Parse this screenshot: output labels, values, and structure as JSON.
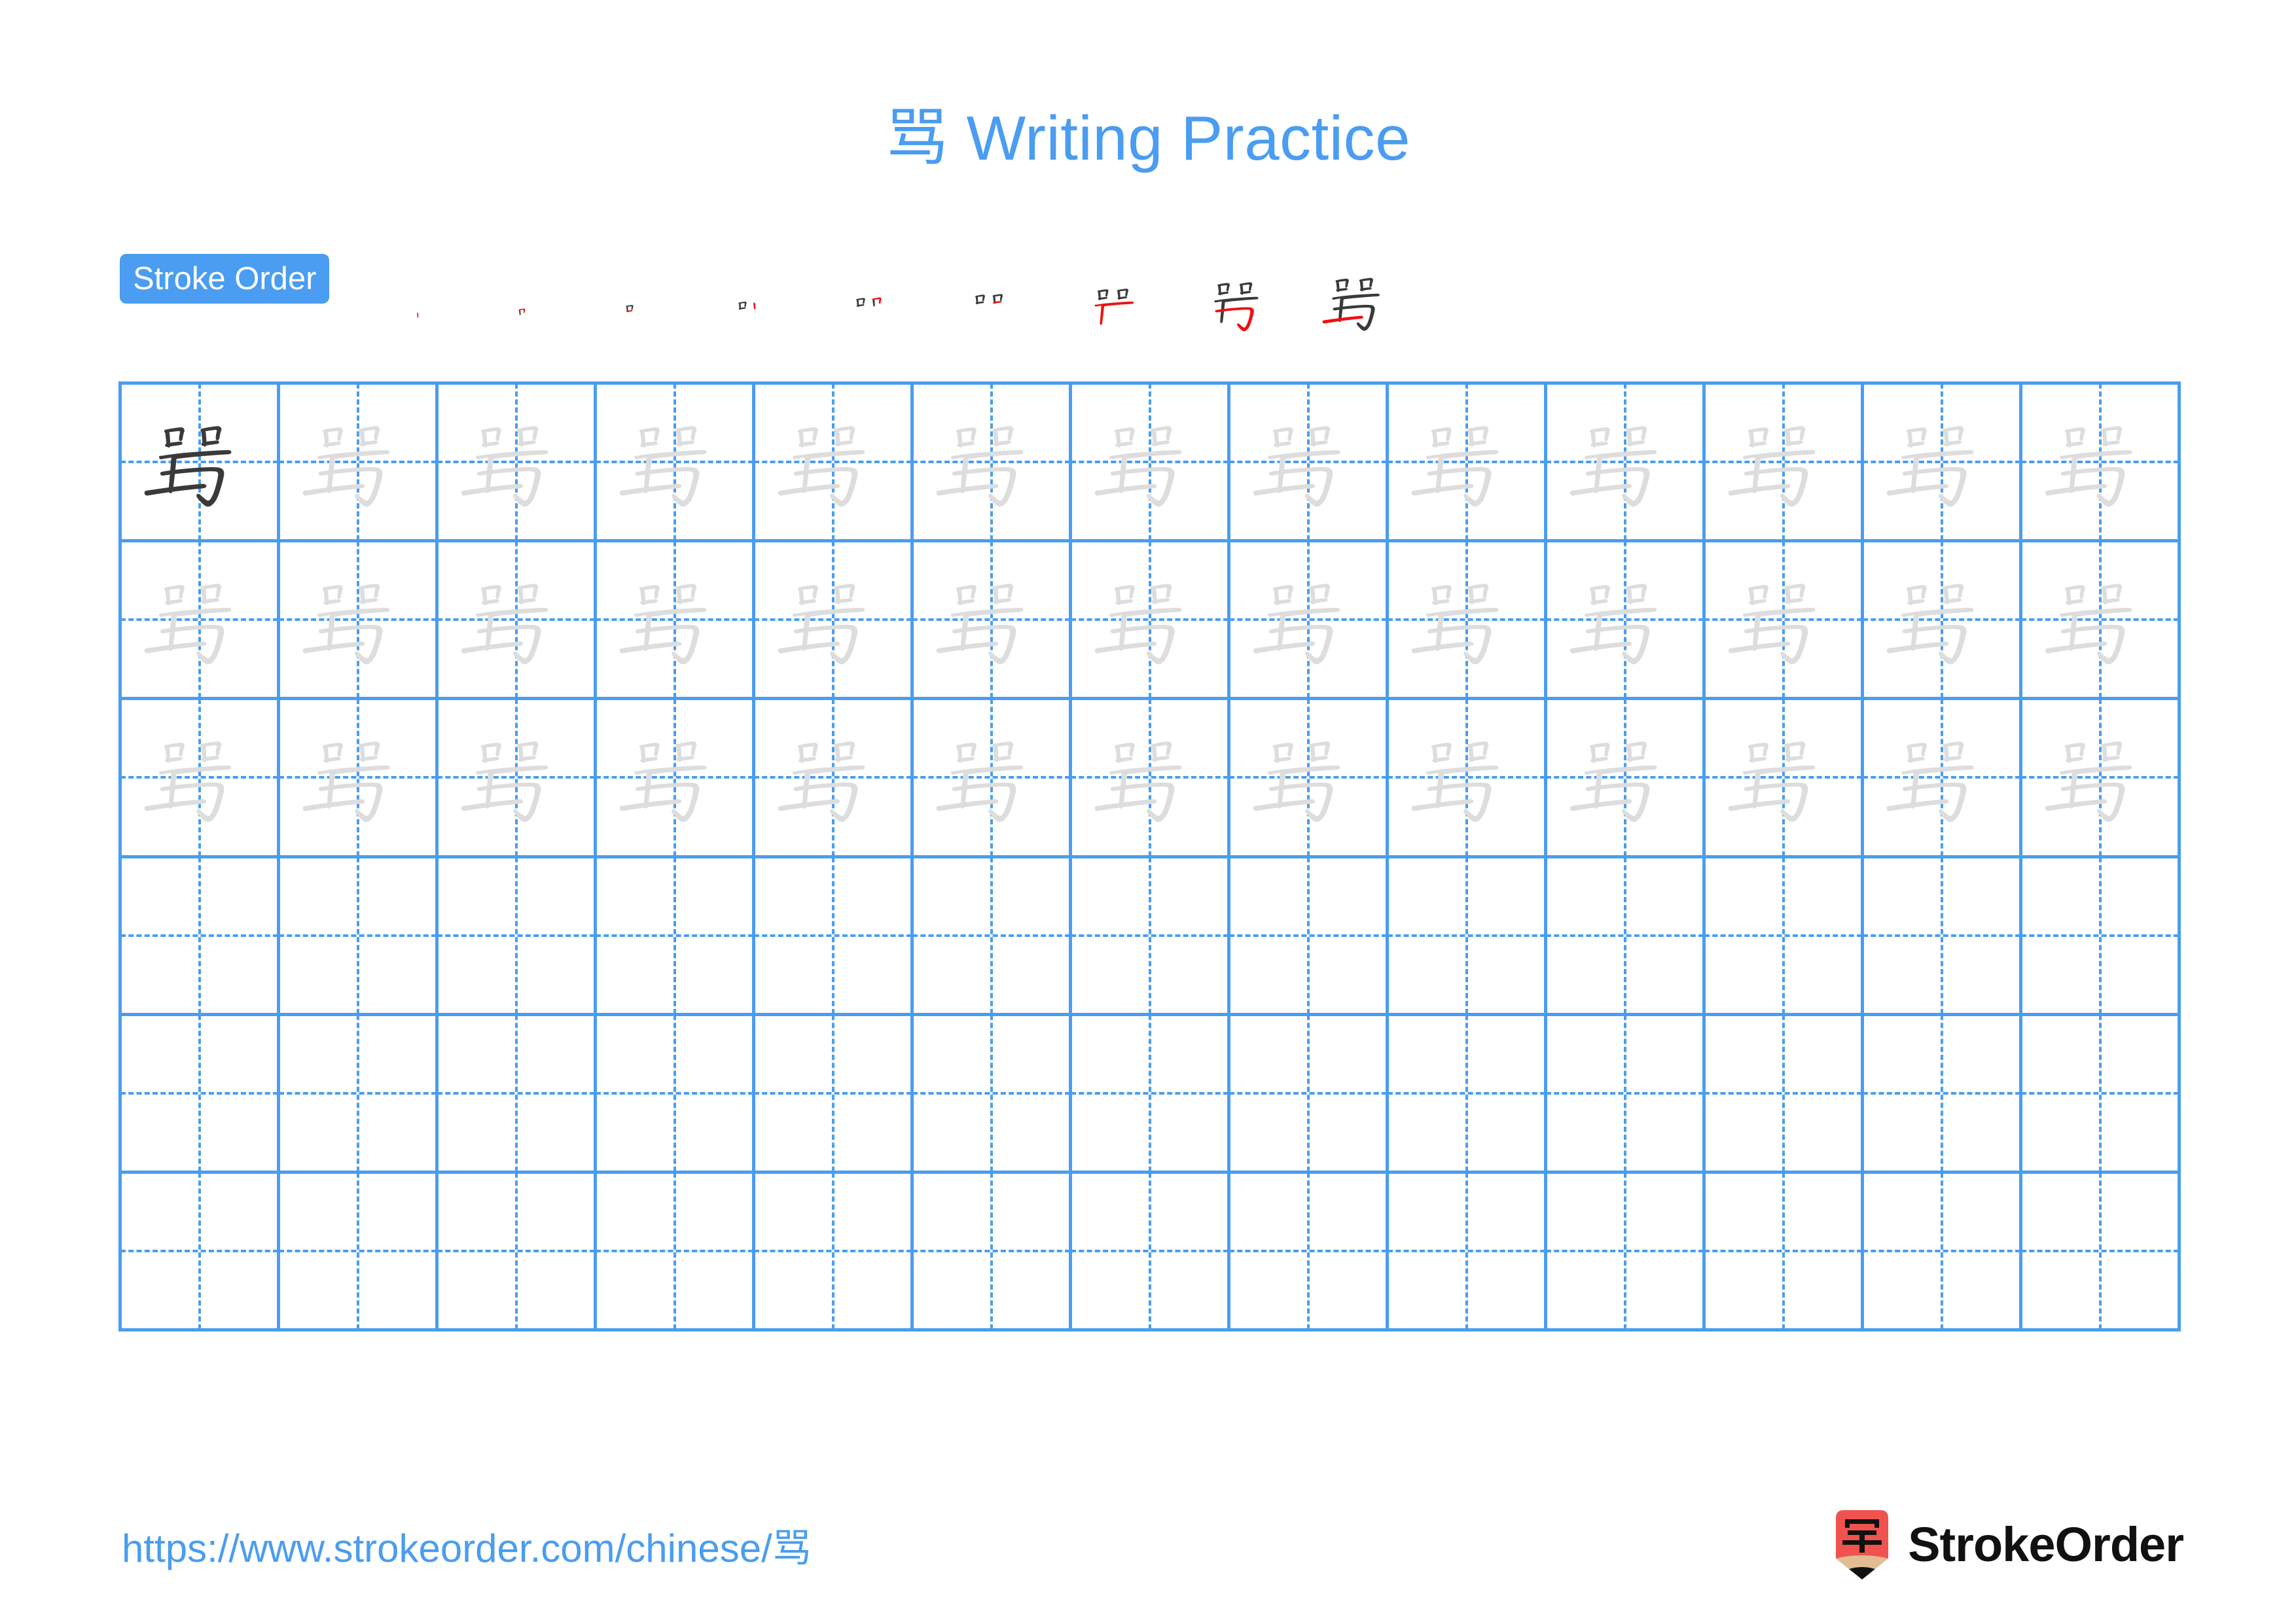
{
  "document": {
    "character": "骂",
    "title": "骂 Writing Practice",
    "page_background": "#ffffff"
  },
  "colors": {
    "accent_blue": "#4a9df0",
    "grid_line": "#4a9df0",
    "guide_line": "#4a9df0",
    "model_char": "#3a3a3a",
    "trace_char": "#dddddd",
    "new_stroke": "#ee1111",
    "logo_red": "#f0534f",
    "logo_wood": "#e3bc94",
    "logo_tip": "#111111",
    "brand_text": "#111111"
  },
  "stroke_order": {
    "badge_label": "Stroke Order",
    "total_strokes": 9,
    "steps": [
      {
        "index": 1,
        "strokes_shown": 1,
        "new_stroke_color": "#ee1111"
      },
      {
        "index": 2,
        "strokes_shown": 2,
        "new_stroke_color": "#ee1111"
      },
      {
        "index": 3,
        "strokes_shown": 3,
        "new_stroke_color": "#ee1111"
      },
      {
        "index": 4,
        "strokes_shown": 4,
        "new_stroke_color": "#ee1111"
      },
      {
        "index": 5,
        "strokes_shown": 5,
        "new_stroke_color": "#ee1111"
      },
      {
        "index": 6,
        "strokes_shown": 6,
        "new_stroke_color": "#ee1111"
      },
      {
        "index": 7,
        "strokes_shown": 7,
        "new_stroke_color": "#ee1111"
      },
      {
        "index": 8,
        "strokes_shown": 8,
        "new_stroke_color": "#ee1111"
      },
      {
        "index": 9,
        "strokes_shown": 9,
        "new_stroke_color": "#ee1111"
      }
    ]
  },
  "practice_grid": {
    "columns": 13,
    "rows": 6,
    "model_cell": {
      "row": 1,
      "column": 1
    },
    "traced_rows": [
      1,
      2,
      3
    ],
    "empty_rows": [
      4,
      5,
      6
    ]
  },
  "footer": {
    "url": "https://www.strokeorder.com/chinese/骂",
    "brand_name": "StrokeOrder",
    "logo_glyph": "字"
  }
}
